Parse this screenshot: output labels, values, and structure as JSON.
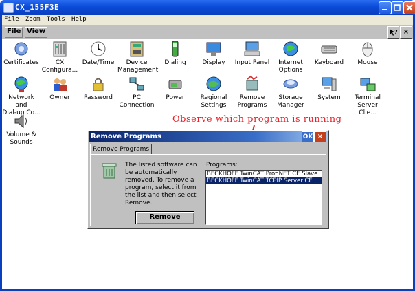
{
  "window": {
    "title": "CX_155F3E"
  },
  "menubar": [
    "File",
    "Zoom",
    "Tools",
    "Help"
  ],
  "cmdbar": {
    "file": "File",
    "view": "View",
    "help_icon": "help-arrow-icon",
    "close_label": "×"
  },
  "icons": [
    {
      "label": "Certificates",
      "icon": "certificates-icon"
    },
    {
      "label": "CX\nConfigura...",
      "icon": "cx-configuration-icon"
    },
    {
      "label": "Date/Time",
      "icon": "clock-icon"
    },
    {
      "label": "Device\nManagement",
      "icon": "device-management-icon"
    },
    {
      "label": "Dialing",
      "icon": "phone-icon"
    },
    {
      "label": "Display",
      "icon": "display-icon"
    },
    {
      "label": "Input Panel",
      "icon": "input-panel-icon"
    },
    {
      "label": "Internet\nOptions",
      "icon": "globe-icon"
    },
    {
      "label": "Keyboard",
      "icon": "keyboard-icon"
    },
    {
      "label": "Mouse",
      "icon": "mouse-icon"
    },
    {
      "label": "Network and\nDial-up Co...",
      "icon": "network-icon"
    },
    {
      "label": "Owner",
      "icon": "owner-icon"
    },
    {
      "label": "Password",
      "icon": "password-icon"
    },
    {
      "label": "PC\nConnection",
      "icon": "pc-connection-icon"
    },
    {
      "label": "Power",
      "icon": "power-icon"
    },
    {
      "label": "Regional\nSettings",
      "icon": "regional-icon"
    },
    {
      "label": "Remove\nPrograms",
      "icon": "remove-programs-icon"
    },
    {
      "label": "Storage\nManager",
      "icon": "storage-icon"
    },
    {
      "label": "System",
      "icon": "system-icon"
    },
    {
      "label": "Terminal\nServer Clie...",
      "icon": "terminal-server-icon"
    },
    {
      "label": "Volume &\nSounds",
      "icon": "volume-icon"
    }
  ],
  "annotation": "Observe which program is running",
  "dialog": {
    "title": "Remove Programs",
    "ok_label": "OK",
    "close_label": "×",
    "tab": "Remove Programs",
    "description": "The listed software can be automatically removed. To remove a program, select it from the list and then select Remove.",
    "programs_label": "Programs:",
    "programs": [
      "BECKHOFF TwinCAT ProfiNET CE Slave",
      "BECKHOFF TwinCAT TCPIP Server CE"
    ],
    "selected_index": 1,
    "remove_label": "Remove"
  },
  "colors": {
    "annotation": "#e8202a",
    "selection": "#0a246a",
    "titlebar": "#0a4bd8"
  }
}
